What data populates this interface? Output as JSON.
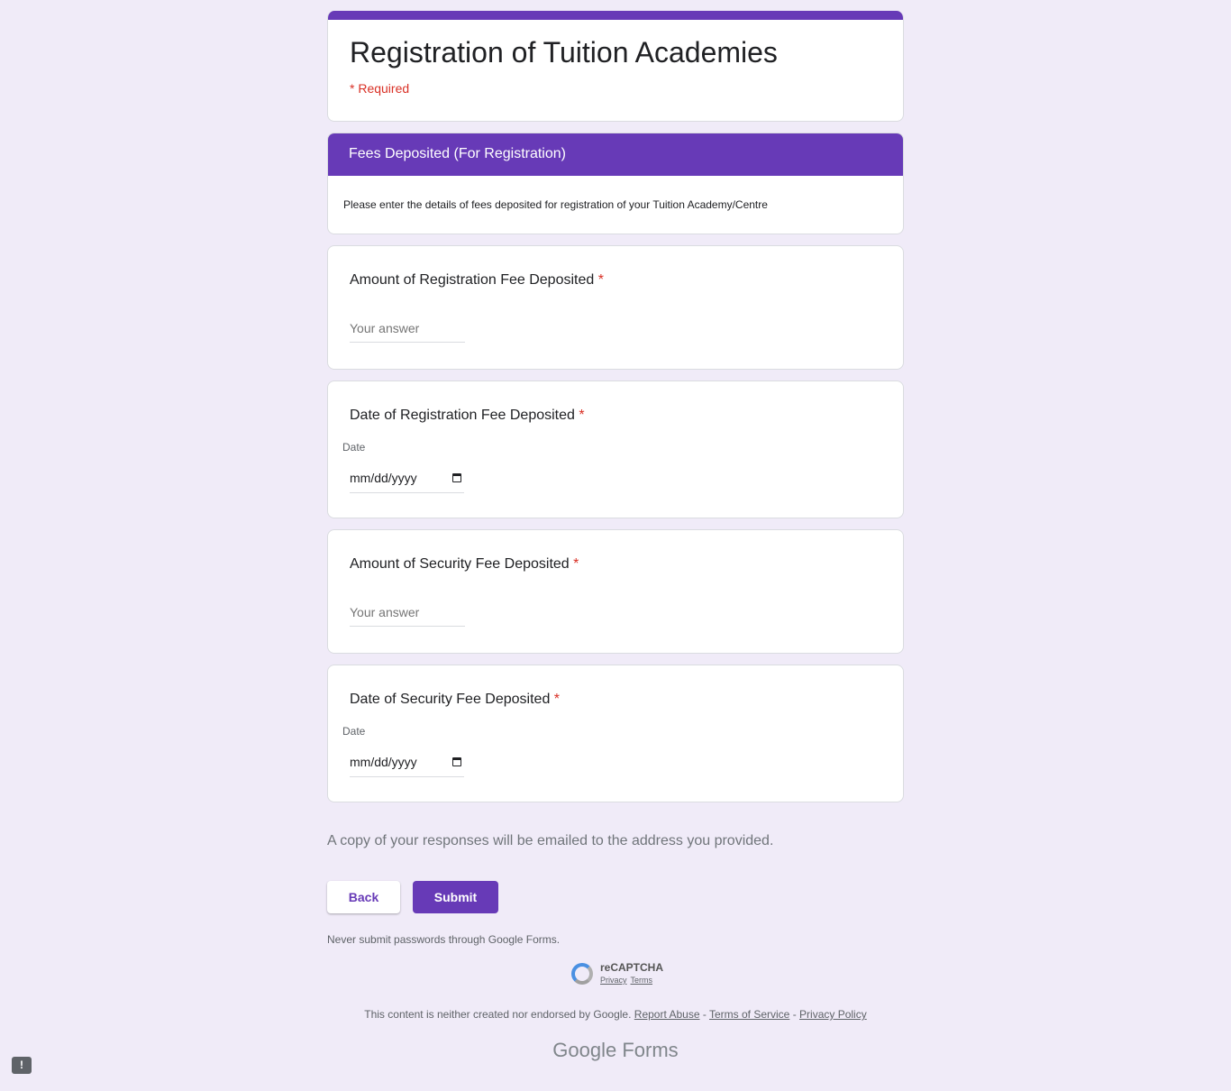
{
  "form": {
    "title": "Registration of Tuition Academies",
    "required_note": "* Required",
    "accent": "#673ab7",
    "background": "#f0ebf8"
  },
  "section": {
    "title": "Fees Deposited (For Registration)",
    "description": "Please enter the details of fees deposited for registration of your Tuition Academy/Centre"
  },
  "questions": [
    {
      "label": "Amount of Registration Fee Deposited",
      "required": "*",
      "placeholder": "Your answer"
    },
    {
      "label": "Date of Registration Fee Deposited",
      "required": "*",
      "date_label": "Date",
      "date_placeholder": "mm/dd/yyyy"
    },
    {
      "label": "Amount of Security Fee Deposited",
      "required": "*",
      "placeholder": "Your answer"
    },
    {
      "label": "Date of Security Fee Deposited",
      "required": "*",
      "date_label": "Date",
      "date_placeholder": "mm/dd/yyyy"
    }
  ],
  "email_note": "A copy of your responses will be emailed to the address you provided.",
  "buttons": {
    "back": "Back",
    "submit": "Submit"
  },
  "password_note": "Never submit passwords through Google Forms.",
  "recaptcha": {
    "title": "reCAPTCHA",
    "privacy": "Privacy",
    "terms": "Terms"
  },
  "footer": {
    "disclaimer": "This content is neither created nor endorsed by Google.",
    "report_abuse": "Report Abuse",
    "sep1": "-",
    "terms": "Terms of Service",
    "sep2": "-",
    "privacy": "Privacy Policy",
    "brand": "Google Forms",
    "report_icon": "!"
  }
}
